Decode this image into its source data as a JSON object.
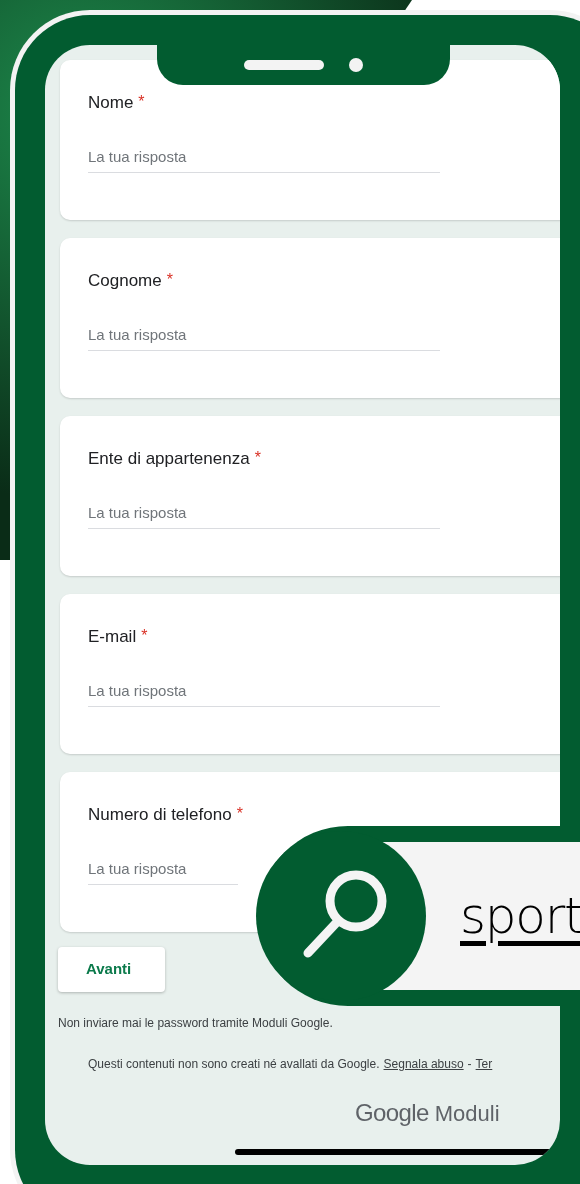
{
  "fields": [
    {
      "label": "Nome",
      "required_mark": "*",
      "placeholder": "La tua risposta"
    },
    {
      "label": "Cognome",
      "required_mark": "*",
      "placeholder": "La tua risposta"
    },
    {
      "label": "Ente di appartenenza",
      "required_mark": "*",
      "placeholder": "La tua risposta"
    },
    {
      "label": "E-mail",
      "required_mark": "*",
      "placeholder": "La tua risposta"
    },
    {
      "label": "Numero di telefono",
      "required_mark": "*",
      "placeholder": "La tua risposta"
    }
  ],
  "next_button": "Avanti",
  "warning": "Non inviare mai le password tramite Moduli Google.",
  "disclaimer": {
    "text": "Questi contenuti non sono creati né avallati da Google.",
    "links": [
      "Segnala abuso",
      "Ter"
    ],
    "separator": "-"
  },
  "brand": {
    "google": "Google",
    "product": "Moduli"
  },
  "search_badge": {
    "text": "sport"
  }
}
